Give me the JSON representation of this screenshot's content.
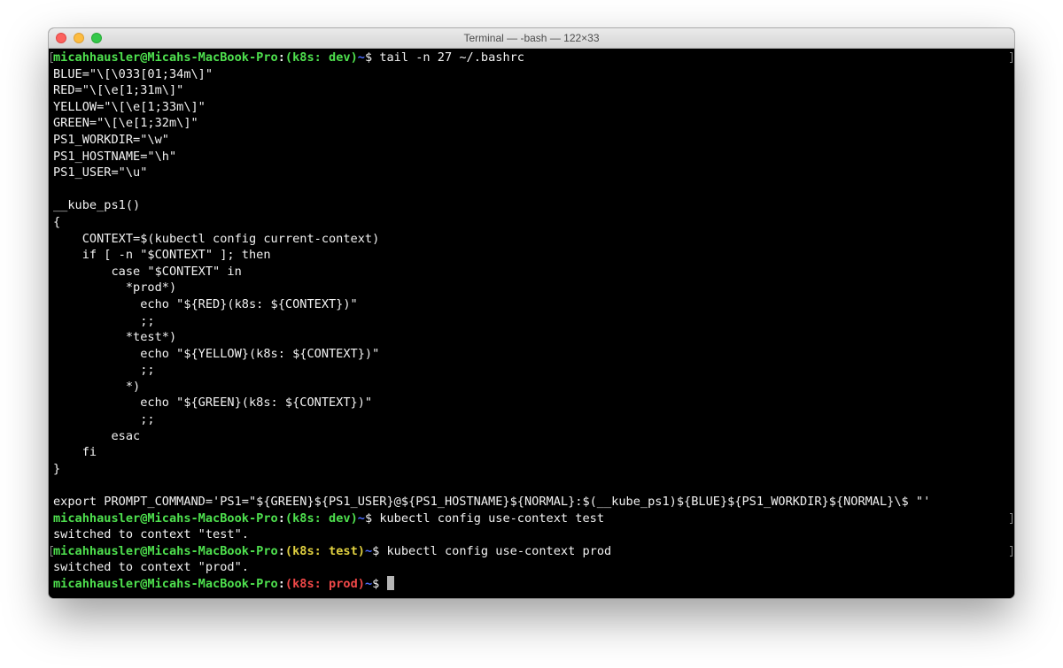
{
  "window": {
    "title": "Terminal — -bash — 122×33"
  },
  "prompts": [
    {
      "user_host": "micahhausler@Micahs-MacBook-Pro",
      "colon": ":",
      "context": "(k8s: dev)",
      "context_color": "green",
      "dir": "~",
      "dollar": "$ ",
      "command": "tail -n 27 ~/.bashrc"
    },
    {
      "user_host": "micahhausler@Micahs-MacBook-Pro",
      "colon": ":",
      "context": "(k8s: dev)",
      "context_color": "green",
      "dir": "~",
      "dollar": "$ ",
      "command": "kubectl config use-context test"
    },
    {
      "user_host": "micahhausler@Micahs-MacBook-Pro",
      "colon": ":",
      "context": "(k8s: test)",
      "context_color": "yellow",
      "dir": "~",
      "dollar": "$ ",
      "command": "kubectl config use-context prod"
    },
    {
      "user_host": "micahhausler@Micahs-MacBook-Pro",
      "colon": ":",
      "context": "(k8s: prod)",
      "context_color": "red",
      "dir": "~",
      "dollar": "$ ",
      "command": ""
    }
  ],
  "bashrc_lines": [
    "BLUE=\"\\[\\033[01;34m\\]\"",
    "RED=\"\\[\\e[1;31m\\]\"",
    "YELLOW=\"\\[\\e[1;33m\\]\"",
    "GREEN=\"\\[\\e[1;32m\\]\"",
    "PS1_WORKDIR=\"\\w\"",
    "PS1_HOSTNAME=\"\\h\"",
    "PS1_USER=\"\\u\"",
    "",
    "__kube_ps1()",
    "{",
    "    CONTEXT=$(kubectl config current-context)",
    "    if [ -n \"$CONTEXT\" ]; then",
    "        case \"$CONTEXT\" in",
    "          *prod*)",
    "            echo \"${RED}(k8s: ${CONTEXT})\"",
    "            ;;",
    "          *test*)",
    "            echo \"${YELLOW}(k8s: ${CONTEXT})\"",
    "            ;;",
    "          *)",
    "            echo \"${GREEN}(k8s: ${CONTEXT})\"",
    "            ;;",
    "        esac",
    "    fi",
    "}",
    "",
    "export PROMPT_COMMAND='PS1=\"${GREEN}${PS1_USER}@${PS1_HOSTNAME}${NORMAL}:$(__kube_ps1)${BLUE}${PS1_WORKDIR}${NORMAL}\\$ \"'"
  ],
  "outputs": [
    "switched to context \"test\".",
    "switched to context \"prod\"."
  ],
  "colors": {
    "background": "#000000",
    "text": "#f2f2f2",
    "green": "#4ee04e",
    "yellow": "#e0d040",
    "red": "#f04848",
    "blue": "#4a6cff",
    "cursor": "#b5b5b5"
  }
}
